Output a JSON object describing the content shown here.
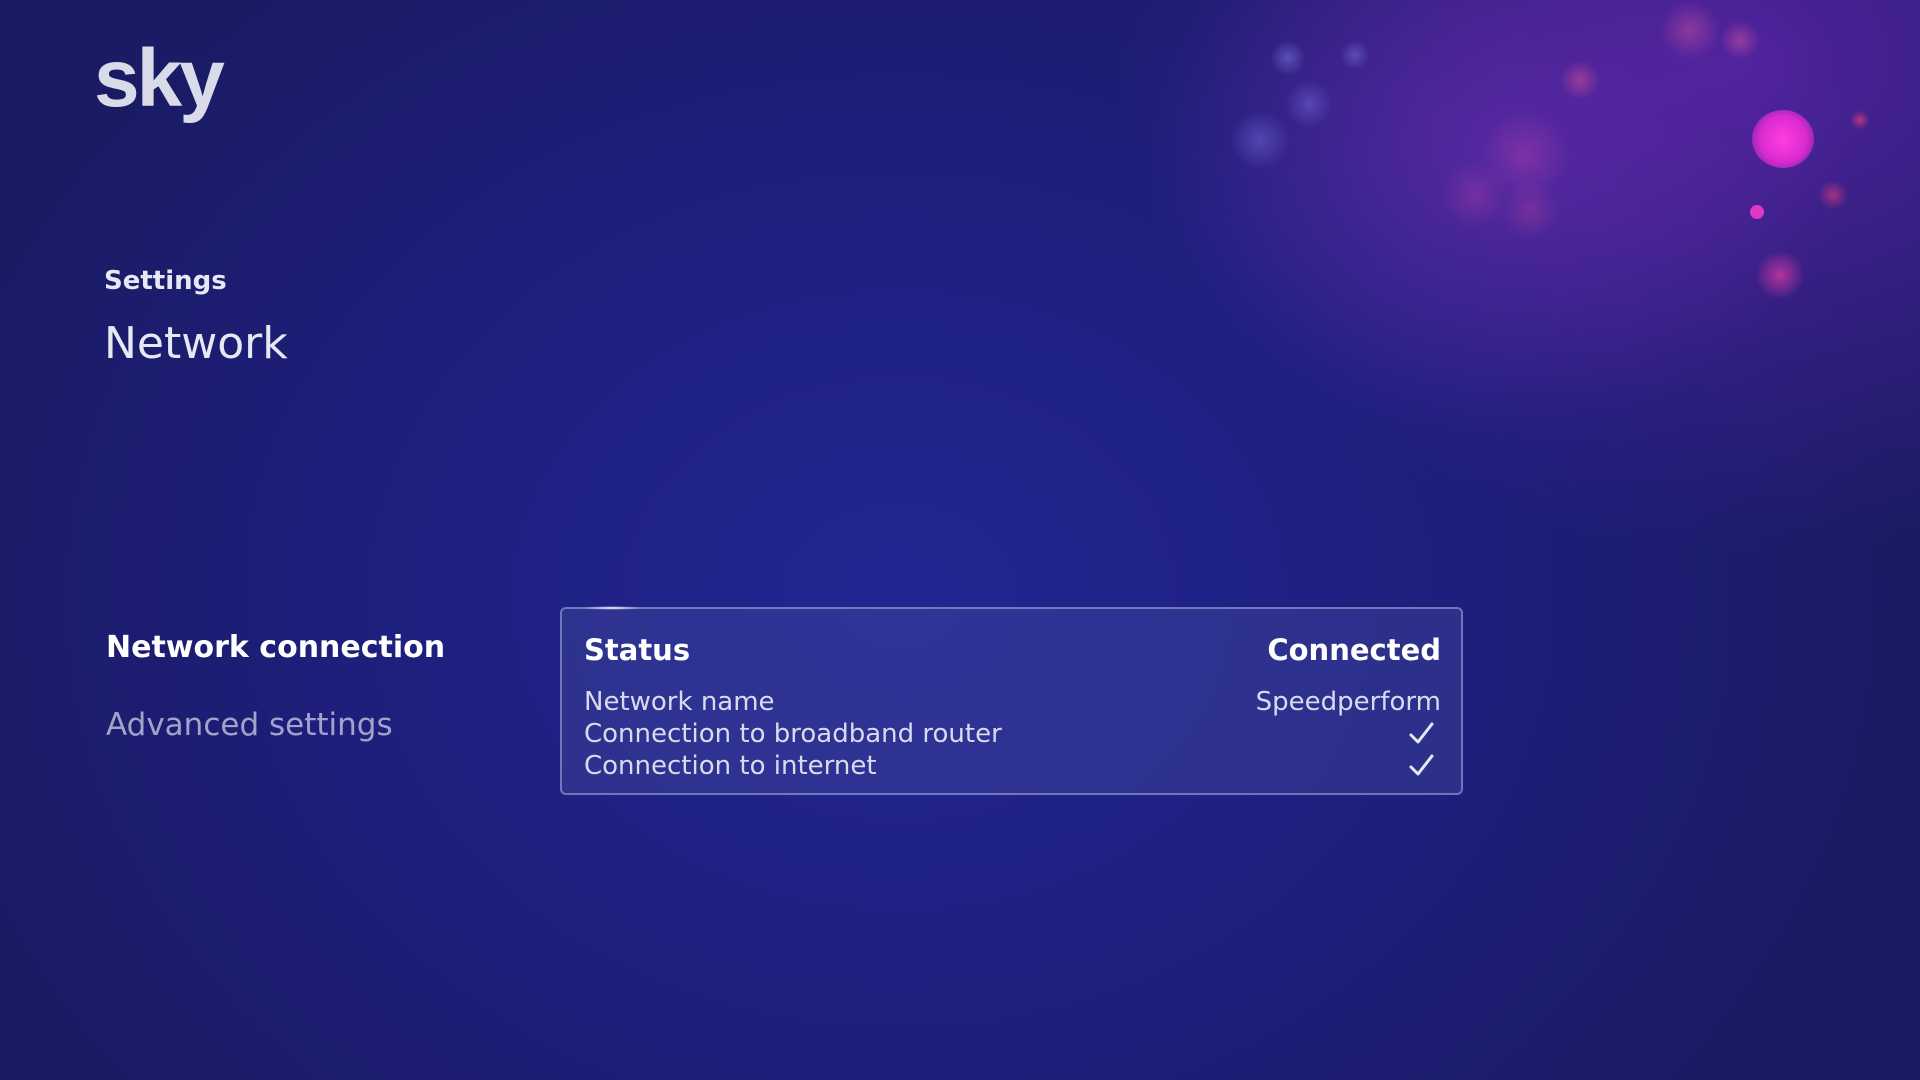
{
  "brand": {
    "logo_text": "sky"
  },
  "header": {
    "breadcrumb": "Settings",
    "title": "Network"
  },
  "menu": {
    "items": [
      {
        "label": "Network connection",
        "selected": true
      },
      {
        "label": "Advanced settings",
        "selected": false
      }
    ]
  },
  "status_panel": {
    "status_label": "Status",
    "status_value": "Connected",
    "rows": [
      {
        "label": "Network name",
        "value": "Speedperform"
      },
      {
        "label": "Connection to broadband router",
        "icon": "checkmark-icon"
      },
      {
        "label": "Connection to internet",
        "icon": "checkmark-icon"
      }
    ]
  },
  "colors": {
    "background": "#1d1f7c",
    "accent": "#d92bd0",
    "text": "#ffffff"
  }
}
